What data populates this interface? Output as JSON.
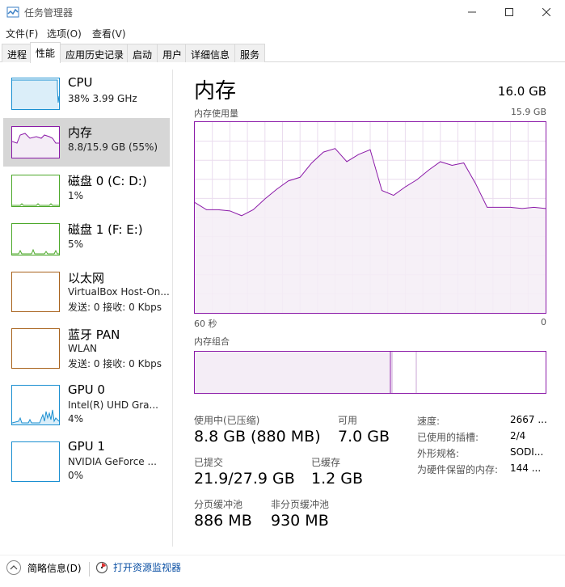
{
  "window": {
    "title": "任务管理器"
  },
  "menu": [
    "文件(F)",
    "选项(O)",
    "查看(V)"
  ],
  "tabs": [
    "进程",
    "性能",
    "应用历史记录",
    "启动",
    "用户",
    "详细信息",
    "服务"
  ],
  "active_tab": "性能",
  "sidebar": {
    "items": [
      {
        "name": "CPU",
        "line1": "38%  3.99 GHz",
        "line2": ""
      },
      {
        "name": "内存",
        "line1": "8.8/15.9 GB (55%)",
        "line2": ""
      },
      {
        "name": "磁盘 0 (C: D:)",
        "line1": "1%",
        "line2": ""
      },
      {
        "name": "磁盘 1 (F: E:)",
        "line1": "5%",
        "line2": ""
      },
      {
        "name": "以太网",
        "line1": "VirtualBox Host-On...",
        "line2": "发送: 0 接收: 0 Kbps"
      },
      {
        "name": "蓝牙 PAN",
        "line1": "WLAN",
        "line2": "发送: 0 接收: 0 Kbps"
      },
      {
        "name": "GPU 0",
        "line1": "Intel(R) UHD Gra...",
        "line2": "4%"
      },
      {
        "name": "GPU 1",
        "line1": "NVIDIA GeForce ...",
        "line2": "0%"
      }
    ]
  },
  "main": {
    "title": "内存",
    "total": "16.0 GB",
    "usage_label": "内存使用量",
    "usage_max": "15.9 GB",
    "time_left": "60 秒",
    "time_right": "0",
    "composition_label": "内存组合",
    "stats": {
      "in_use_label": "使用中(已压缩)",
      "in_use_value": "8.8 GB (880 MB)",
      "available_label": "可用",
      "available_value": "7.0 GB",
      "committed_label": "已提交",
      "committed_value": "21.9/27.9 GB",
      "cached_label": "已缓存",
      "cached_value": "1.2 GB",
      "paged_label": "分页缓冲池",
      "paged_value": "886 MB",
      "nonpaged_label": "非分页缓冲池",
      "nonpaged_value": "930 MB"
    },
    "details": [
      {
        "label": "速度:",
        "value": "2667 ..."
      },
      {
        "label": "已使用的插槽:",
        "value": "2/4"
      },
      {
        "label": "外形规格:",
        "value": "SODI..."
      },
      {
        "label": "为硬件保留的内存:",
        "value": "144 ..."
      }
    ]
  },
  "footer": {
    "fewer_details": "简略信息(D)",
    "open_monitor": "打开资源监视器"
  },
  "colors": {
    "memory": "#8b1aa8",
    "cpu": "#1a8fd1",
    "disk": "#4ca82a",
    "network": "#a7611b",
    "gpu": "#1a8fd1"
  },
  "chart_data": {
    "type": "area",
    "title": "内存使用量",
    "x": [
      60,
      58,
      56,
      54,
      52,
      50,
      48,
      46,
      44,
      42,
      40,
      38,
      36,
      34,
      32,
      30,
      28,
      26,
      24,
      22,
      20,
      18,
      16,
      14,
      12,
      10,
      8,
      6,
      4,
      2,
      0
    ],
    "values": [
      9.2,
      8.6,
      8.6,
      8.5,
      8.1,
      8.6,
      9.5,
      10.3,
      11.0,
      11.3,
      12.5,
      13.4,
      13.7,
      12.6,
      13.2,
      13.6,
      10.2,
      9.8,
      10.5,
      11.1,
      11.9,
      12.6,
      12.3,
      12.5,
      10.8,
      8.8,
      8.8,
      8.8,
      8.7,
      8.8,
      8.7
    ],
    "xlabel": "",
    "ylabel": "",
    "ylim": [
      0,
      15.9
    ],
    "xlim": [
      60,
      0
    ]
  }
}
